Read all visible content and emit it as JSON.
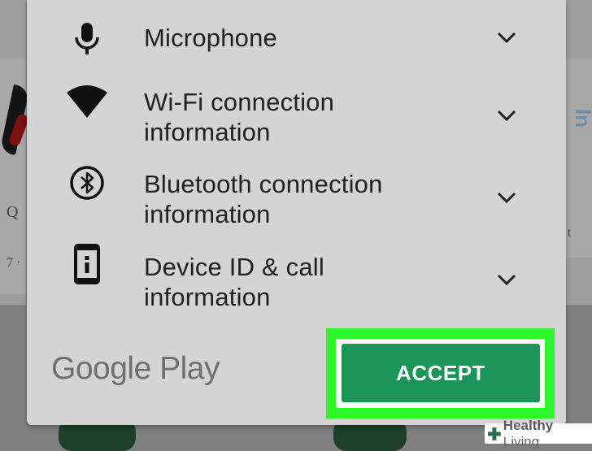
{
  "dialog": {
    "permissions": [
      {
        "icon": "microphone-icon",
        "label": "Microphone"
      },
      {
        "icon": "wifi-icon",
        "label": "Wi-Fi connection information"
      },
      {
        "icon": "bluetooth-icon",
        "label": "Bluetooth connection information"
      },
      {
        "icon": "device-info-icon",
        "label": "Device ID & call information"
      }
    ],
    "brand": "Google Play",
    "accept_label": "ACCEPT"
  },
  "background": {
    "left_text_1": "Q",
    "left_text_2": "7 ·",
    "right_text_1": "ln",
    "right_text_2": "t"
  },
  "watermark": {
    "bold": "Healthy",
    "rest": " Living"
  },
  "colors": {
    "accept_button": "#1b9458",
    "highlight": "#2ef52e",
    "dialog_bg": "#d4d4d4",
    "overlay": "#808080"
  }
}
